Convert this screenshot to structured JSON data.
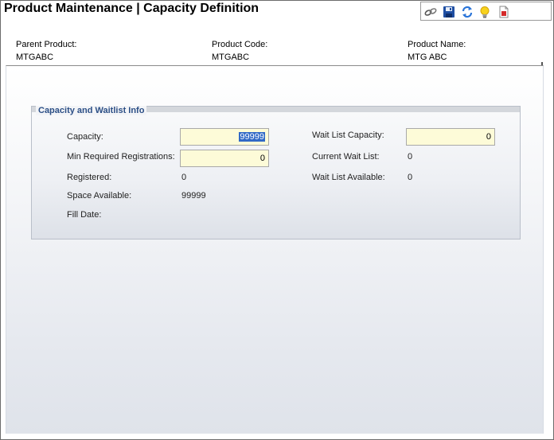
{
  "page": {
    "title": "Product Maintenance  |  Capacity Definition"
  },
  "toolbar": {
    "icons": [
      "link-icon",
      "save-icon",
      "refresh-icon",
      "lightbulb-icon",
      "pdf-report-icon"
    ]
  },
  "header": {
    "parent_product_label": "Parent Product:",
    "parent_product_value": "MTGABC",
    "product_code_label": "Product Code:",
    "product_code_value": "MTGABC",
    "product_name_label": "Product Name:",
    "product_name_value": "MTG ABC"
  },
  "group": {
    "title": "Capacity and Waitlist Info",
    "capacity_label": "Capacity:",
    "capacity_value": "99999",
    "min_required_label": "Min Required Registrations:",
    "min_required_value": "0",
    "registered_label": "Registered:",
    "registered_value": "0",
    "space_available_label": "Space Available:",
    "space_available_value": "99999",
    "fill_date_label": "Fill Date:",
    "fill_date_value": "",
    "wait_list_capacity_label": "Wait List Capacity:",
    "wait_list_capacity_value": "0",
    "current_wait_list_label": "Current Wait List:",
    "current_wait_list_value": "0",
    "wait_list_available_label": "Wait List Available:",
    "wait_list_available_value": "0"
  },
  "colors": {
    "input_bg": "#fdfbd8",
    "group_title": "#2c4f86",
    "selection": "#3169c6"
  }
}
